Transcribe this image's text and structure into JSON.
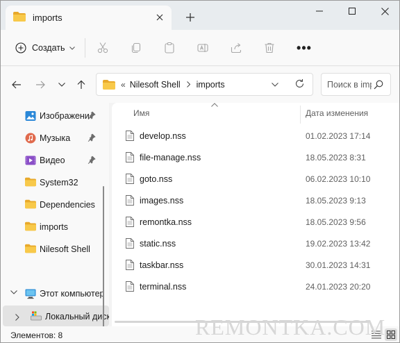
{
  "window": {
    "tab_title": "imports",
    "new_tab_symbol": "+"
  },
  "toolbar": {
    "create_label": "Создать",
    "icons": [
      "cut-icon",
      "copy-icon",
      "paste-icon",
      "rename-icon",
      "share-icon",
      "delete-icon"
    ],
    "more_label": "•••"
  },
  "address": {
    "overflow": "«",
    "crumbs": [
      "Nilesoft Shell",
      "imports"
    ],
    "search_placeholder": "Поиск в imports"
  },
  "sidebar": {
    "items": [
      {
        "label": "Изображени",
        "icon": "pictures-icon",
        "pinned": true
      },
      {
        "label": "Музыка",
        "icon": "music-icon",
        "pinned": true
      },
      {
        "label": "Видео",
        "icon": "video-icon",
        "pinned": true
      },
      {
        "label": "System32",
        "icon": "folder-icon",
        "pinned": false
      },
      {
        "label": "Dependencies",
        "icon": "folder-icon",
        "pinned": false
      },
      {
        "label": "imports",
        "icon": "folder-icon",
        "pinned": false
      },
      {
        "label": "Nilesoft Shell",
        "icon": "folder-icon",
        "pinned": false
      },
      {
        "label": "Этот компьютер",
        "icon": "this-pc-icon",
        "pinned": false
      },
      {
        "label": "Локальный диск",
        "icon": "drive-icon",
        "pinned": false
      }
    ]
  },
  "columns": {
    "name": "Имя",
    "date": "Дата изменения"
  },
  "files": [
    {
      "name": "develop.nss",
      "date": "01.02.2023 17:14"
    },
    {
      "name": "file-manage.nss",
      "date": "18.05.2023 8:31"
    },
    {
      "name": "goto.nss",
      "date": "06.02.2023 10:10"
    },
    {
      "name": "images.nss",
      "date": "18.05.2023 9:13"
    },
    {
      "name": "remontka.nss",
      "date": "18.05.2023 9:56"
    },
    {
      "name": "static.nss",
      "date": "19.02.2023 13:42"
    },
    {
      "name": "taskbar.nss",
      "date": "30.01.2023 14:31"
    },
    {
      "name": "terminal.nss",
      "date": "24.01.2023 20:20"
    }
  ],
  "status": {
    "count_text": "Элементов: 8"
  },
  "watermark": "REMONTKA.COM",
  "colors": {
    "folder": "#f3c343",
    "accent": "#0067c0"
  }
}
